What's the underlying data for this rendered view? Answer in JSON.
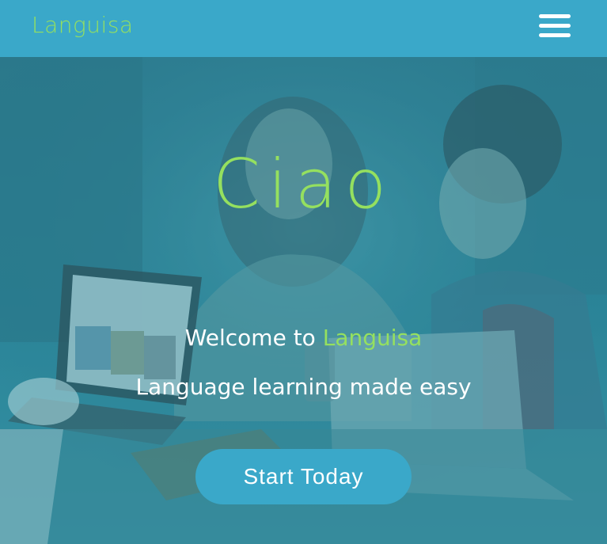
{
  "navbar": {
    "brand": "Languisa",
    "menu_icon": "hamburger-menu-icon"
  },
  "hero": {
    "heading": "Ciao",
    "welcome_prefix": "Welcome to ",
    "welcome_brand": "Languisa",
    "tagline": "Language learning made easy",
    "cta_label": "Start Today"
  },
  "colors": {
    "navbar_bg": "#3aa8c9",
    "brand_green": "#95e05f",
    "text_white": "#ffffff",
    "button_bg": "#3aa8c9"
  }
}
